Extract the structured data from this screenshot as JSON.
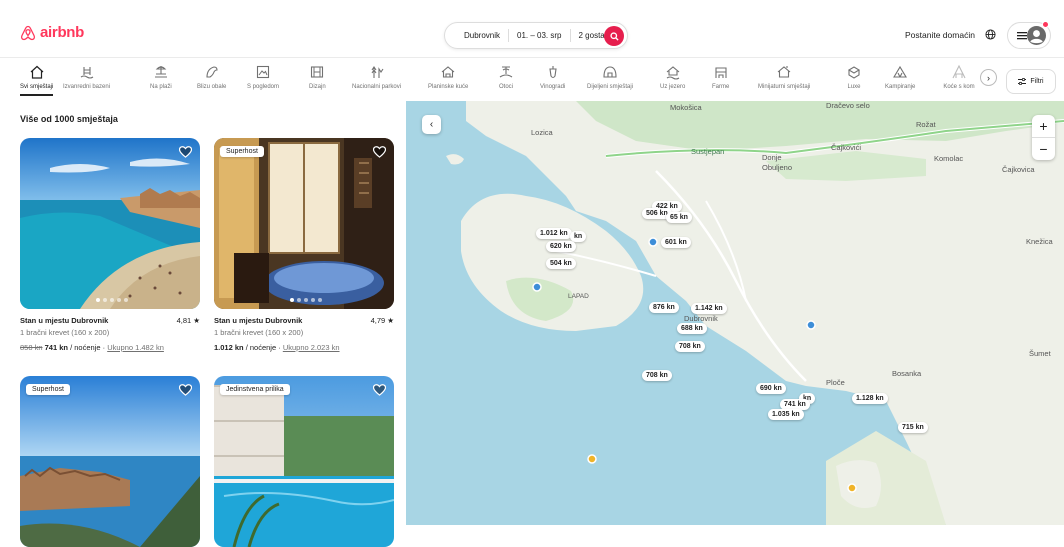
{
  "brand": {
    "name": "airbnb",
    "color": "#ff385c"
  },
  "search": {
    "location": "Dubrovnik",
    "dates": "01. – 03. srp",
    "guests": "2 gosta"
  },
  "header": {
    "host_label": "Postanite domaćin"
  },
  "categories": [
    {
      "label": "Svi smještaji",
      "icon": "home-icon"
    },
    {
      "label": "Izvanredni bazeni",
      "icon": "pool-icon"
    },
    {
      "label": "Na plaži",
      "icon": "beach-icon"
    },
    {
      "label": "Blizu obale",
      "icon": "surf-icon"
    },
    {
      "label": "S pogledom",
      "icon": "view-icon"
    },
    {
      "label": "Dizajn",
      "icon": "design-icon"
    },
    {
      "label": "Nacionalni parkovi",
      "icon": "park-icon"
    },
    {
      "label": "Planinske kuće",
      "icon": "cabin-icon"
    },
    {
      "label": "Otoci",
      "icon": "island-icon"
    },
    {
      "label": "Vinogradi",
      "icon": "vineyard-icon"
    },
    {
      "label": "Dijeljeni smještaji",
      "icon": "shared-icon"
    },
    {
      "label": "Uz jezero",
      "icon": "lake-icon"
    },
    {
      "label": "Farme",
      "icon": "farm-icon"
    },
    {
      "label": "Minijaturni smještaji",
      "icon": "tiny-home-icon"
    },
    {
      "label": "Luxe",
      "icon": "luxe-icon"
    },
    {
      "label": "Kampiranje",
      "icon": "camping-icon"
    },
    {
      "label": "Koće s kom",
      "icon": "a-frame-icon"
    }
  ],
  "filters_label": "Filtri",
  "results_title": "Više od 1000 smještaja",
  "listings": [
    {
      "badge": "",
      "title": "Stan u mjestu Dubrovnik",
      "rating": "4,81",
      "beds": "1 bračni krevet (160 x 200)",
      "old_price": "858 kn",
      "price": "741 kn",
      "per": " / noćenje · ",
      "total": "Ukupno 1.482 kn"
    },
    {
      "badge": "Superhost",
      "title": "Stan u mjestu Dubrovnik",
      "rating": "4,79",
      "beds": "1 bračni krevet (160 x 200)",
      "old_price": "",
      "price": "1.012 kn",
      "per": " / noćenje · ",
      "total": "Ukupno 2.023 kn"
    },
    {
      "badge": "Superhost"
    },
    {
      "badge": "Jedinstvena prilika"
    }
  ],
  "map": {
    "places": [
      "Mokošica",
      "Dračevo selo",
      "Rožat",
      "Lozica",
      "Sustjepan",
      "Čajkovići",
      "Donje",
      "Obuljeno",
      "Komolac",
      "Čajkovica",
      "Knežica",
      "LAPAD",
      "Dubrovnik",
      "Ploče",
      "Bosanka",
      "Šumet"
    ],
    "prices": [
      "422 kn",
      "506 kn",
      "65 kn",
      "1.012 kn",
      "kn",
      "620 kn",
      "601 kn",
      "504 kn",
      "876 kn",
      "1.142 kn",
      "688 kn",
      "708 kn",
      "708 kn",
      "690 kn",
      "kn",
      "741 kn",
      "1.128 kn",
      "1.035 kn",
      "715 kn"
    ]
  }
}
